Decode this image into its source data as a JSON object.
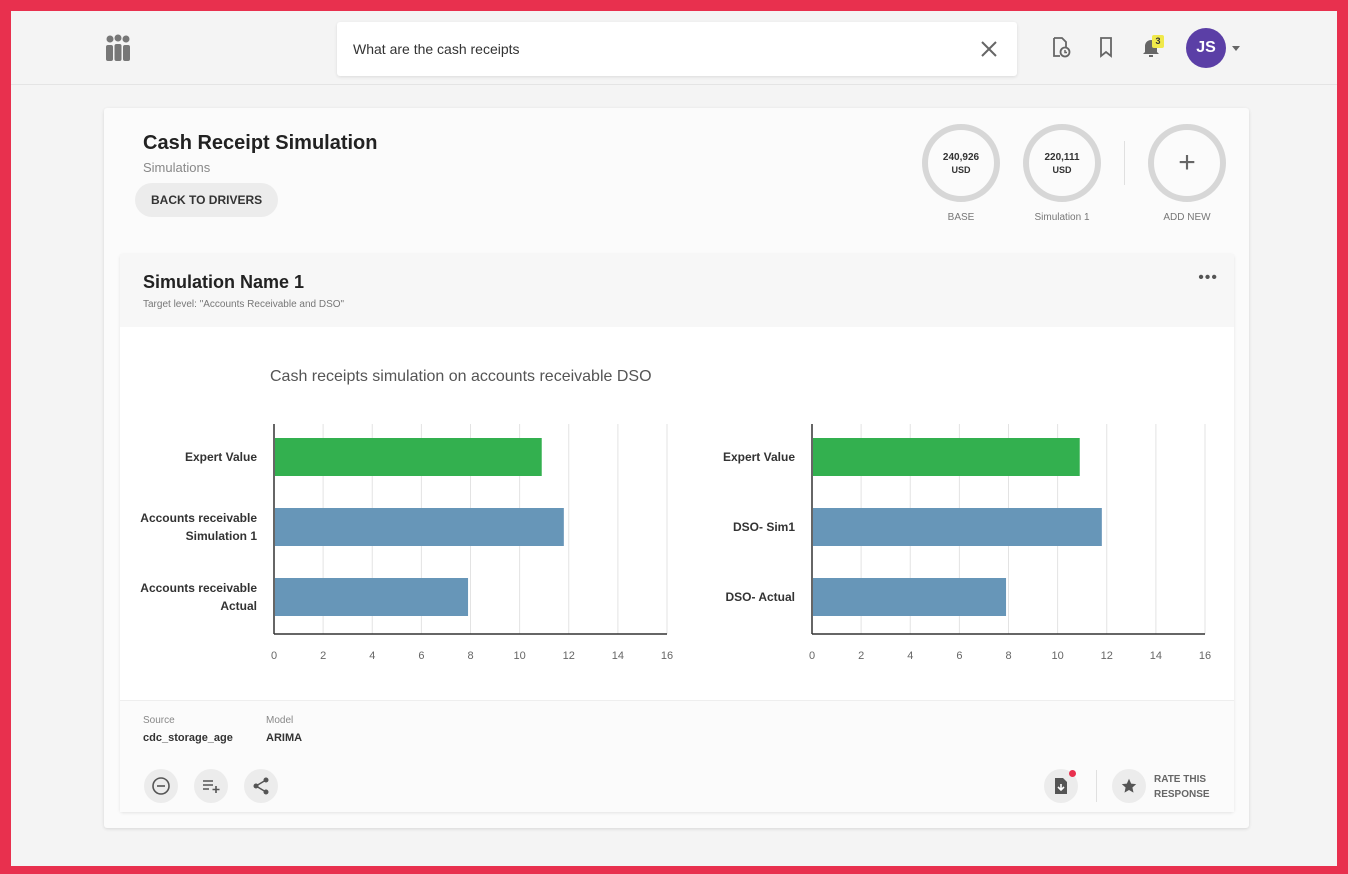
{
  "search": {
    "query": "What are the cash receipts"
  },
  "notifications": {
    "count": "3"
  },
  "user": {
    "initials": "JS"
  },
  "header": {
    "title": "Cash Receipt Simulation",
    "subtitle": "Simulations",
    "back_label": "BACK TO DRIVERS"
  },
  "scenarios": [
    {
      "value": "240,926",
      "unit": "USD",
      "label": "BASE"
    },
    {
      "value": "220,111",
      "unit": "USD",
      "label": "Simulation 1"
    }
  ],
  "add_new": {
    "label": "ADD NEW",
    "symbol": "+"
  },
  "simulation": {
    "name": "Simulation Name 1",
    "target": "Target level: \"Accounts Receivable and DSO\"",
    "more": "•••"
  },
  "chart_title": "Cash receipts simulation on accounts receivable DSO",
  "chart_data": [
    {
      "type": "bar",
      "orientation": "horizontal",
      "categories": [
        [
          "Expert Value"
        ],
        [
          "Accounts receivable",
          "Simulation 1"
        ],
        [
          "Accounts receivable",
          "Actual"
        ]
      ],
      "values": [
        10.9,
        11.8,
        7.9
      ],
      "colors": [
        "#33b04f",
        "#6796b8",
        "#6796b8"
      ],
      "xticks": [
        "0",
        "2",
        "4",
        "6",
        "8",
        "10",
        "12",
        "14",
        "16"
      ],
      "xlim": [
        0,
        16
      ],
      "grid": true
    },
    {
      "type": "bar",
      "orientation": "horizontal",
      "categories": [
        [
          "Expert Value"
        ],
        [
          "DSO- Sim1"
        ],
        [
          "DSO- Actual"
        ]
      ],
      "values": [
        10.9,
        11.8,
        7.9
      ],
      "colors": [
        "#33b04f",
        "#6796b8",
        "#6796b8"
      ],
      "xticks": [
        "0",
        "2",
        "4",
        "6",
        "8",
        "10",
        "12",
        "14",
        "16"
      ],
      "xlim": [
        0,
        16
      ],
      "grid": true
    }
  ],
  "meta": {
    "source_label": "Source",
    "source_value": "cdc_storage_age",
    "model_label": "Model",
    "model_value": "ARIMA"
  },
  "rate": {
    "line1": "RATE THIS",
    "line2": "RESPONSE"
  },
  "colors": {
    "accent_frame": "#e8304e",
    "avatar": "#5b3fa6",
    "green_bar": "#33b04f",
    "blue_bar": "#6796b8"
  },
  "icons": [
    "logo-icon",
    "close-icon",
    "document-clock-icon",
    "bookmark-icon",
    "bell-icon",
    "chevron-down-icon",
    "plus-icon",
    "more-icon",
    "minus-circle-icon",
    "playlist-add-icon",
    "share-icon",
    "file-download-icon",
    "star-icon"
  ]
}
